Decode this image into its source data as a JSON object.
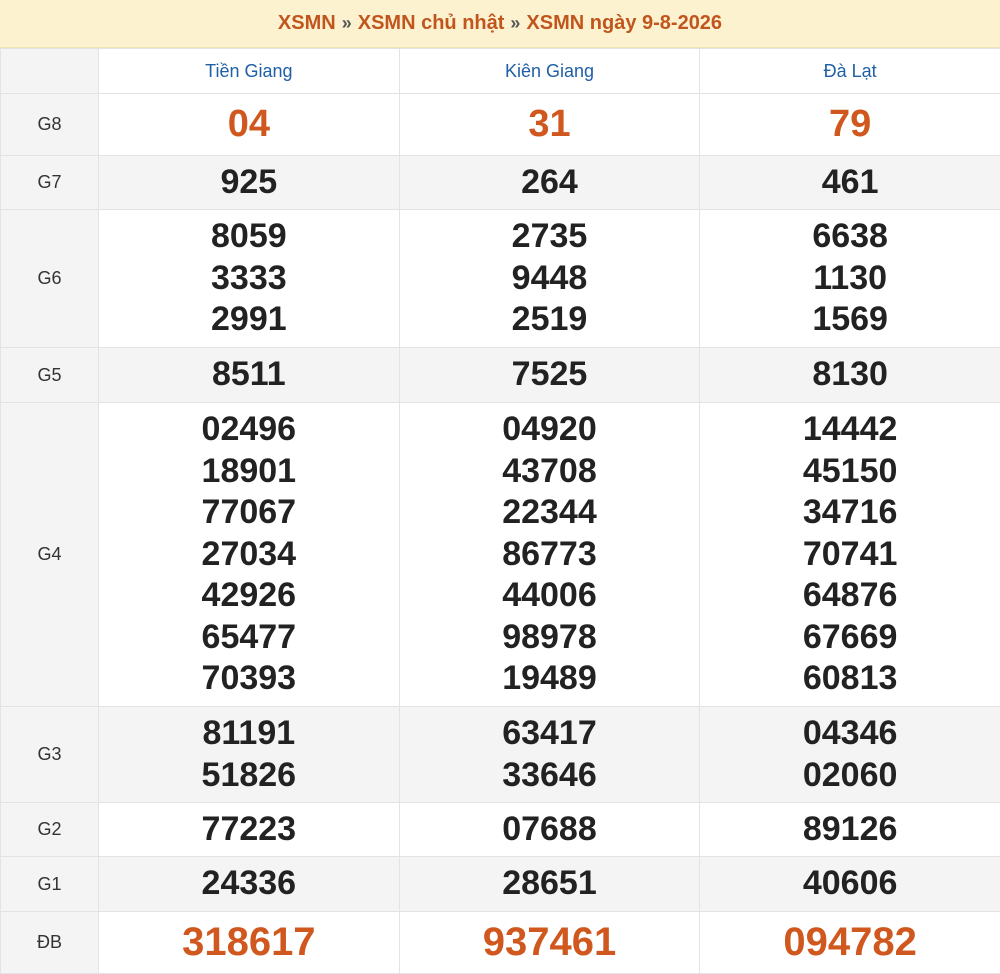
{
  "breadcrumb": {
    "items": [
      "XSMN",
      "XSMN chủ nhật",
      "XSMN ngày 9-8-2026"
    ],
    "separator": "»"
  },
  "table": {
    "corner": "",
    "provinces": [
      "Tiền Giang",
      "Kiên Giang",
      "Đà Lạt"
    ],
    "prizes": [
      {
        "label": "G8",
        "values": [
          [
            "04"
          ],
          [
            "31"
          ],
          [
            "79"
          ]
        ]
      },
      {
        "label": "G7",
        "values": [
          [
            "925"
          ],
          [
            "264"
          ],
          [
            "461"
          ]
        ]
      },
      {
        "label": "G6",
        "values": [
          [
            "8059",
            "3333",
            "2991"
          ],
          [
            "2735",
            "9448",
            "2519"
          ],
          [
            "6638",
            "1130",
            "1569"
          ]
        ]
      },
      {
        "label": "G5",
        "values": [
          [
            "8511"
          ],
          [
            "7525"
          ],
          [
            "8130"
          ]
        ]
      },
      {
        "label": "G4",
        "values": [
          [
            "02496",
            "18901",
            "77067",
            "27034",
            "42926",
            "65477",
            "70393"
          ],
          [
            "04920",
            "43708",
            "22344",
            "86773",
            "44006",
            "98978",
            "19489"
          ],
          [
            "14442",
            "45150",
            "34716",
            "70741",
            "64876",
            "67669",
            "60813"
          ]
        ]
      },
      {
        "label": "G3",
        "values": [
          [
            "81191",
            "51826"
          ],
          [
            "63417",
            "33646"
          ],
          [
            "04346",
            "02060"
          ]
        ]
      },
      {
        "label": "G2",
        "values": [
          [
            "77223"
          ],
          [
            "07688"
          ],
          [
            "89126"
          ]
        ]
      },
      {
        "label": "G1",
        "values": [
          [
            "24336"
          ],
          [
            "28651"
          ],
          [
            "40606"
          ]
        ]
      },
      {
        "label": "ĐB",
        "values": [
          [
            "318617"
          ],
          [
            "937461"
          ],
          [
            "094782"
          ]
        ]
      }
    ]
  },
  "colors": {
    "highlight": "#d0581f",
    "header_link": "#1f5fa6",
    "breadcrumb_bg": "#fdf2cf"
  }
}
